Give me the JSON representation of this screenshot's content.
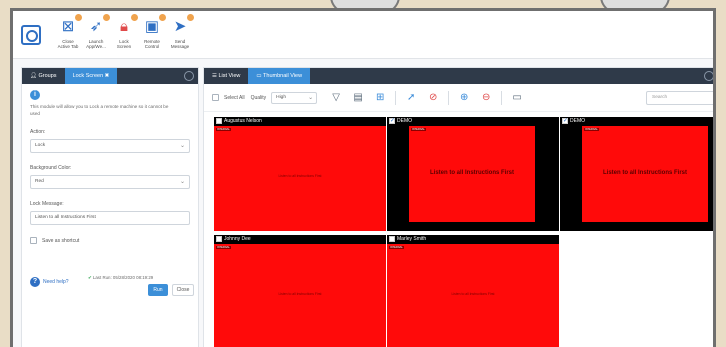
{
  "toolbar": {
    "buttons": [
      {
        "label": "Close\nActive Tab",
        "icon": "close-tab-icon"
      },
      {
        "label": "Launch\nApp/We...",
        "icon": "rocket-icon"
      },
      {
        "label": "Lock\nScreen",
        "icon": "lock-icon"
      },
      {
        "label": "Remote\nControl",
        "icon": "monitor-icon"
      },
      {
        "label": "Send\nMessage",
        "icon": "send-icon"
      }
    ]
  },
  "left_panel": {
    "tabs": [
      {
        "label": "Groups",
        "icon": "user-icon"
      },
      {
        "label": "Lock Screen",
        "icon": "close-icon"
      }
    ],
    "description": "This module will allow you to Lock a remote machine so it cannot be used",
    "action_label": "Action:",
    "action_value": "Lock",
    "bg_color_label": "Background Color:",
    "bg_color_value": "Red",
    "lock_message_label": "Lock Message:",
    "lock_message_value": "Listen to all Instructions First",
    "save_shortcut_label": "Save as shortcut",
    "need_help": "Need help?",
    "last_run": "Last Run: 05/28/2020 08:19:29",
    "run_label": "Run",
    "close_label": "Close"
  },
  "right_panel": {
    "tabs": [
      {
        "label": "List View"
      },
      {
        "label": "Thumbnail View"
      }
    ],
    "select_all_label": "Select All",
    "quality_label": "Quality",
    "quality_value": "High",
    "search_placeholder": "Search",
    "tiles": [
      {
        "name": "Augustus Nelson",
        "checked": false,
        "message": "Listen to all Instructions First",
        "badge": "INTERNAL",
        "style": "small"
      },
      {
        "name": "DEMO",
        "checked": true,
        "message": "Listen to all Instructions First",
        "badge": "INTERNAL",
        "style": "big"
      },
      {
        "name": "DEMO",
        "checked": true,
        "message": "Listen to all Instructions First",
        "badge": "INTERNAL",
        "style": "big"
      },
      {
        "name": "Johnny Dee",
        "checked": false,
        "message": "Listen to all Instructions First",
        "badge": "INTERNAL",
        "style": "small"
      },
      {
        "name": "Marley Smith",
        "checked": false,
        "message": "Listen to all Instructions First",
        "badge": "INTERNAL",
        "style": "small"
      }
    ]
  },
  "colors": {
    "accent": "#3c8fd8",
    "dark_tab_bar": "#2f3a49",
    "lock_red": "#ff0a0a"
  }
}
